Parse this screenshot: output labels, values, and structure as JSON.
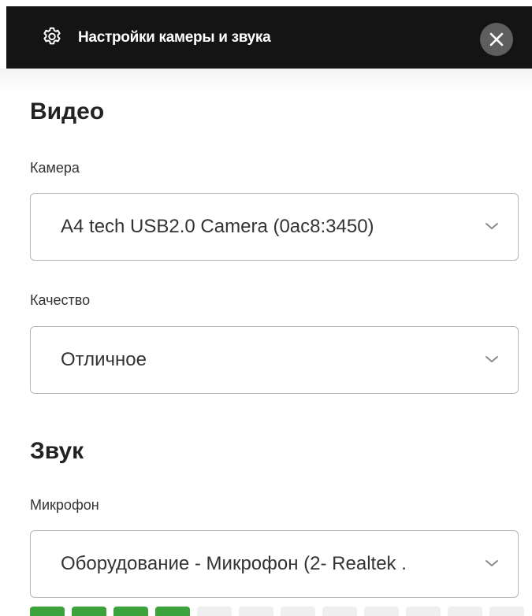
{
  "header": {
    "title": "Настройки камеры и звука",
    "settings_icon": "gear-icon",
    "close_icon": "close-icon"
  },
  "video": {
    "heading": "Видео",
    "camera_label": "Камера",
    "camera_value": "A4 tech USB2.0 Camera (0ac8:3450)",
    "quality_label": "Качество",
    "quality_value": "Отличное"
  },
  "audio": {
    "heading": "Звук",
    "microphone_label": "Микрофон",
    "microphone_value": "Оборудование - Микрофон (2- Realtek ."
  },
  "mic_level": {
    "segments_total": 12,
    "segments_active": 4
  },
  "colors": {
    "header_bg": "#141414",
    "close_bg": "#5e5e5e",
    "meter_active": "#3ca33c",
    "meter_inactive": "#efefef"
  }
}
